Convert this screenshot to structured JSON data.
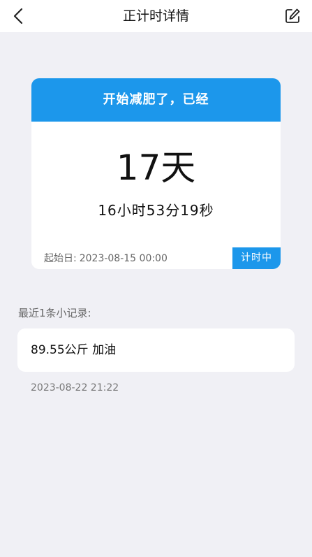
{
  "header": {
    "title": "正计时详情",
    "back_icon": "chevron-left-icon",
    "edit_icon": "edit-icon"
  },
  "timer": {
    "heading": "开始减肥了，已经",
    "days": "17天",
    "hms": "16小时53分19秒",
    "start_label": "起始日:",
    "start_value": "2023-08-15 00:00",
    "status": "计时中"
  },
  "records": {
    "label": "最近1条小记录:",
    "items": [
      {
        "text": "89.55公斤 加油",
        "time": "2023-08-22 21:22"
      }
    ]
  },
  "colors": {
    "accent": "#1c97eb",
    "background": "#f0f0f5"
  }
}
